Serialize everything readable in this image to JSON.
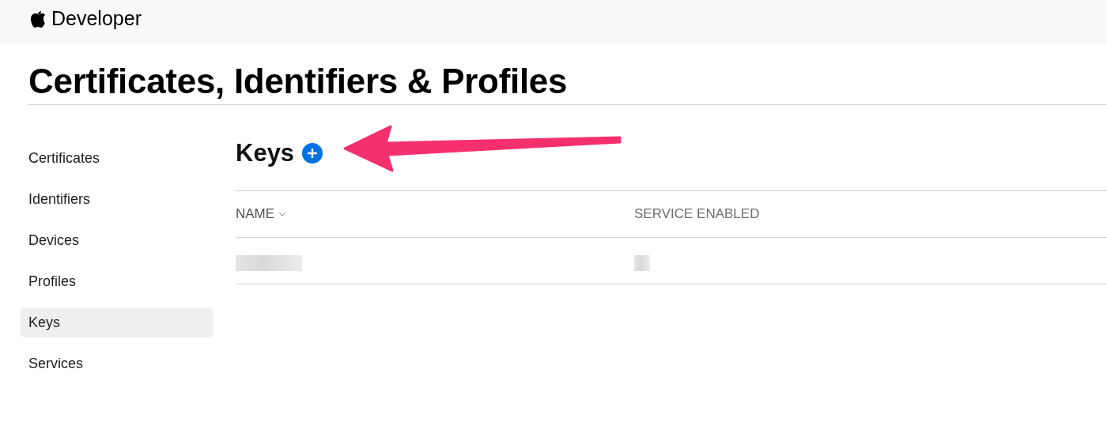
{
  "header": {
    "brand": "Developer"
  },
  "page_title": "Certificates, Identifiers & Profiles",
  "sidebar": {
    "items": [
      {
        "label": "Certificates",
        "selected": false
      },
      {
        "label": "Identifiers",
        "selected": false
      },
      {
        "label": "Devices",
        "selected": false
      },
      {
        "label": "Profiles",
        "selected": false
      },
      {
        "label": "Keys",
        "selected": true
      },
      {
        "label": "Services",
        "selected": false
      }
    ]
  },
  "section": {
    "title": "Keys"
  },
  "table": {
    "columns": [
      {
        "label": "NAME",
        "sorted": true
      },
      {
        "label": "SERVICE ENABLED",
        "sorted": false
      }
    ],
    "rows": [
      {
        "cells": [
          {
            "kind": "redacted"
          },
          {
            "kind": "redacted"
          }
        ]
      }
    ]
  }
}
